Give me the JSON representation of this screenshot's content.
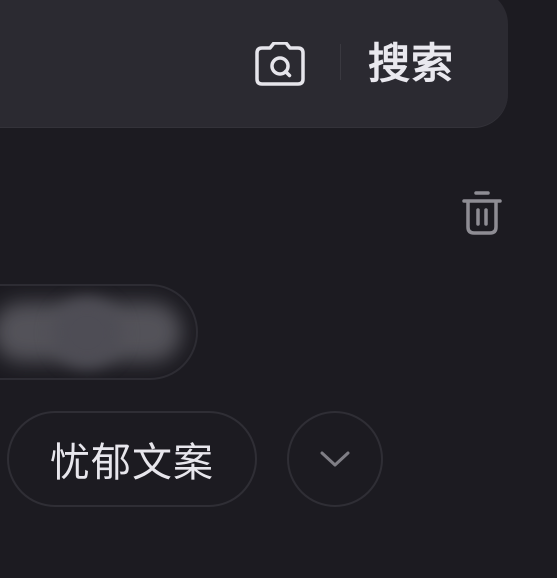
{
  "search": {
    "button_label": "搜索",
    "camera_icon": "camera-search-icon"
  },
  "history": {
    "clear_icon": "trash-icon",
    "chips": [
      {
        "label": "忧郁文案"
      }
    ],
    "expand_icon": "chevron-down-icon"
  },
  "colors": {
    "background": "#1c1b21",
    "search_bar": "#2b2a31",
    "chip_border": "#2f2e35",
    "text": "#e7e6ec",
    "icon_muted": "#8e8d94"
  }
}
